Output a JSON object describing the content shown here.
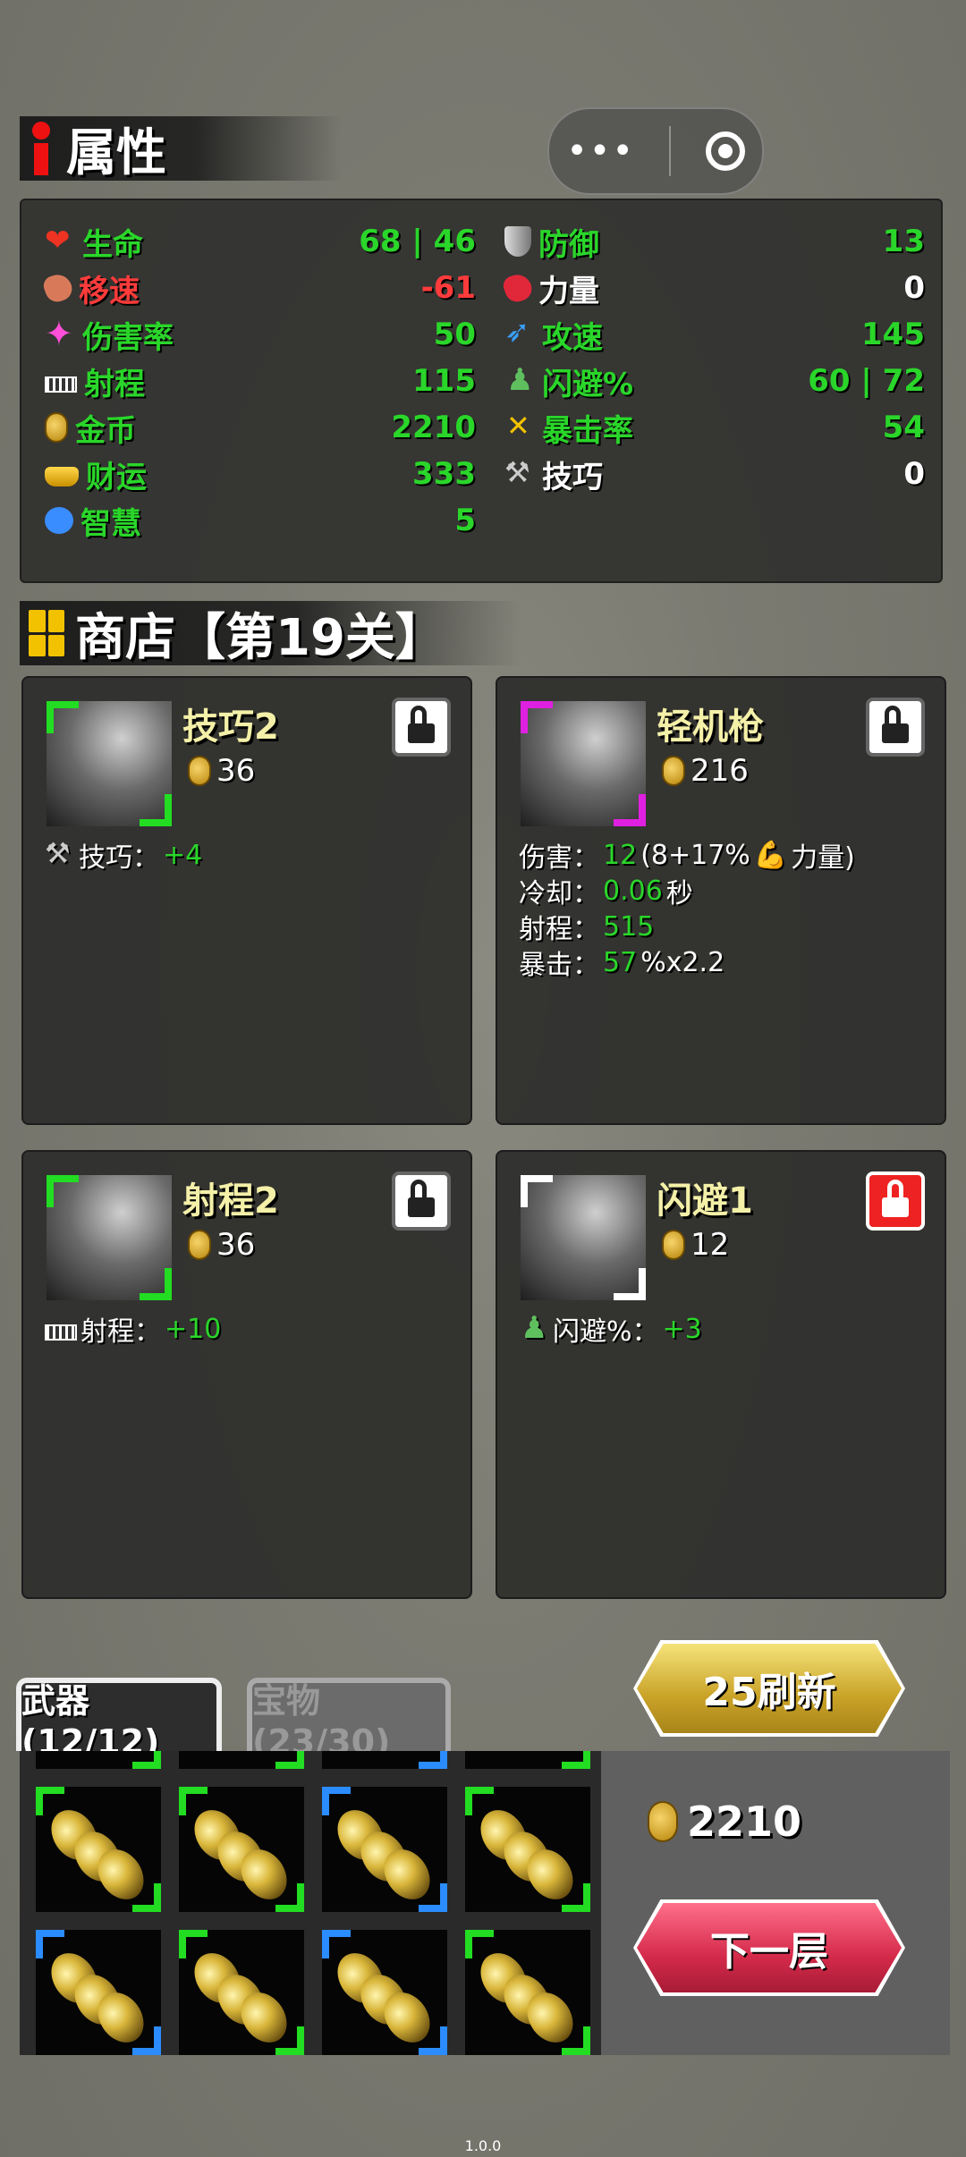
{
  "attributes": {
    "title": "属性",
    "left": [
      {
        "icon": "heart-icon",
        "label": "生命",
        "value": "68 | 46",
        "label_color": "green",
        "value_color": "green"
      },
      {
        "icon": "leg-icon",
        "label": "移速",
        "value": "-61",
        "label_color": "red",
        "value_color": "red"
      },
      {
        "icon": "sparkle-icon",
        "label": "伤害率",
        "value": "50",
        "label_color": "green",
        "value_color": "green"
      },
      {
        "icon": "ruler-icon",
        "label": "射程",
        "value": "115",
        "label_color": "green",
        "value_color": "green"
      },
      {
        "icon": "coin-icon",
        "label": "金币",
        "value": "2210",
        "label_color": "green",
        "value_color": "green"
      },
      {
        "icon": "ingot-icon",
        "label": "财运",
        "value": "333",
        "label_color": "green",
        "value_color": "green"
      },
      {
        "icon": "brain-icon",
        "label": "智慧",
        "value": "5",
        "label_color": "green",
        "value_color": "green"
      }
    ],
    "right": [
      {
        "icon": "shield-icon",
        "label": "防御",
        "value": "13",
        "label_color": "green",
        "value_color": "green"
      },
      {
        "icon": "arm-icon",
        "label": "力量",
        "value": "0",
        "label_color": "white",
        "value_color": "white"
      },
      {
        "icon": "feather-icon",
        "label": "攻速",
        "value": "145",
        "label_color": "green",
        "value_color": "green"
      },
      {
        "icon": "person-icon",
        "label": "闪避%",
        "value": "60 | 72",
        "label_color": "green",
        "value_color": "green"
      },
      {
        "icon": "crit-icon",
        "label": "暴击率",
        "value": "54",
        "label_color": "green",
        "value_color": "green"
      },
      {
        "icon": "wrench-icon",
        "label": "技巧",
        "value": "0",
        "label_color": "white",
        "value_color": "white"
      }
    ]
  },
  "shop": {
    "title": "商店【第19关】",
    "cards": [
      {
        "name": "技巧2",
        "price": "36",
        "corner_color": "#22dd22",
        "locked_red": false,
        "desc": [
          {
            "icon": "wrench-icon",
            "parts": [
              {
                "t": "技巧：",
                "c": "w"
              },
              {
                "t": "+4",
                "c": "g"
              }
            ]
          }
        ]
      },
      {
        "name": "轻机枪",
        "price": "216",
        "corner_color": "#e020e0",
        "locked_red": false,
        "desc": [
          {
            "parts": [
              {
                "t": "伤害：",
                "c": "w"
              },
              {
                "t": "12",
                "c": "g"
              },
              {
                "t": "(8+17%",
                "c": "w"
              },
              {
                "t": "💪",
                "c": "r"
              },
              {
                "t": "力量)",
                "c": "w"
              }
            ]
          },
          {
            "parts": [
              {
                "t": "冷却：",
                "c": "w"
              },
              {
                "t": "0.06",
                "c": "g"
              },
              {
                "t": "秒",
                "c": "w"
              }
            ]
          },
          {
            "parts": [
              {
                "t": "射程：",
                "c": "w"
              },
              {
                "t": "515",
                "c": "g"
              }
            ]
          },
          {
            "parts": [
              {
                "t": "暴击：",
                "c": "w"
              },
              {
                "t": "57",
                "c": "g"
              },
              {
                "t": "%x2.2",
                "c": "w"
              }
            ]
          }
        ]
      },
      {
        "name": "射程2",
        "price": "36",
        "corner_color": "#22dd22",
        "locked_red": false,
        "desc": [
          {
            "icon": "ruler-icon",
            "parts": [
              {
                "t": "射程：",
                "c": "w"
              },
              {
                "t": "+10",
                "c": "g"
              }
            ]
          }
        ]
      },
      {
        "name": "闪避1",
        "price": "12",
        "corner_color": "#ffffff",
        "locked_red": true,
        "desc": [
          {
            "icon": "person-icon",
            "parts": [
              {
                "t": "闪避%：",
                "c": "w"
              },
              {
                "t": "+3",
                "c": "g"
              }
            ]
          }
        ]
      }
    ]
  },
  "tabs": {
    "weapons": "武器(12/12)",
    "treasures": "宝物(23/30)"
  },
  "inventory": {
    "row1_colors": [
      "#22dd22",
      "#22dd22",
      "#2b8cff",
      "#22dd22"
    ],
    "row2_colors": [
      "#2b8cff",
      "#22dd22",
      "#2b8cff",
      "#22dd22"
    ]
  },
  "sidebar": {
    "coins": "2210",
    "refresh_label": "25刷新",
    "next_label": "下一层"
  },
  "version": "1.0.0"
}
